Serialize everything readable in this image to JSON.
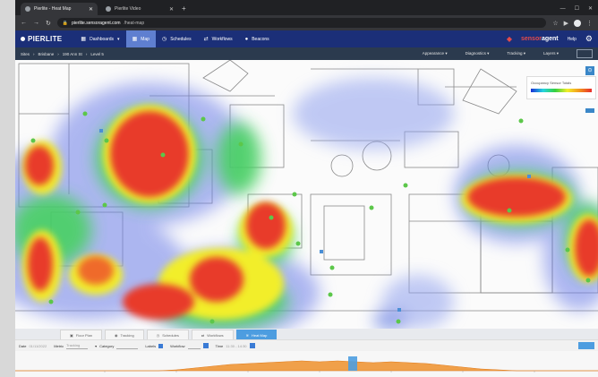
{
  "browser": {
    "tabs": [
      {
        "label": "Pierlite - Heat Map",
        "active": true
      },
      {
        "label": "Pierlite Video",
        "active": false
      }
    ],
    "new_tab": "+",
    "url_host": "pierlite.sensoragent.com",
    "url_path": "/heat-map"
  },
  "app": {
    "logo": "PIERLITE",
    "nav": [
      {
        "label": "Dashboards",
        "icon": "dashboard-icon",
        "active": false
      },
      {
        "label": "Map",
        "icon": "map-icon",
        "active": true
      },
      {
        "label": "Schedules",
        "icon": "clock-icon",
        "active": false
      },
      {
        "label": "Workflows",
        "icon": "workflow-icon",
        "active": false
      },
      {
        "label": "Beacons",
        "icon": "beacon-icon",
        "active": false
      }
    ],
    "brand_a": "sensor",
    "brand_b": "agent",
    "help": "Help"
  },
  "subbar": {
    "crumbs": [
      "Sites",
      "Brisbane",
      "190 Ann St",
      "Level 5"
    ],
    "menus": [
      "Appearance",
      "Diagnostics",
      "Tracking",
      "Layers"
    ]
  },
  "legend": {
    "title": "Occupancy Sensor Totals"
  },
  "map_tabs": [
    {
      "label": "Floor Plan",
      "active": false
    },
    {
      "label": "Tracking",
      "active": false
    },
    {
      "label": "Schedules",
      "active": false
    },
    {
      "label": "Workflows",
      "active": false
    },
    {
      "label": "Heat Map",
      "active": true
    }
  ],
  "filters": {
    "date_label": "Date",
    "date_value": "01/11/2022",
    "metric_label": "Metric",
    "metric_value": "Tracking",
    "category_label": "Category",
    "labels_label": "Labels",
    "workflow_label": "Workflow",
    "time_label": "Time",
    "time_value": "11:30 - 14:30"
  },
  "colors": {
    "nav_bg": "#1b2f78",
    "nav_active": "#5f7fd0",
    "accent": "#4d9de0",
    "heat_hot": "#e82c2c",
    "heat_cool": "#3b5bdb"
  }
}
